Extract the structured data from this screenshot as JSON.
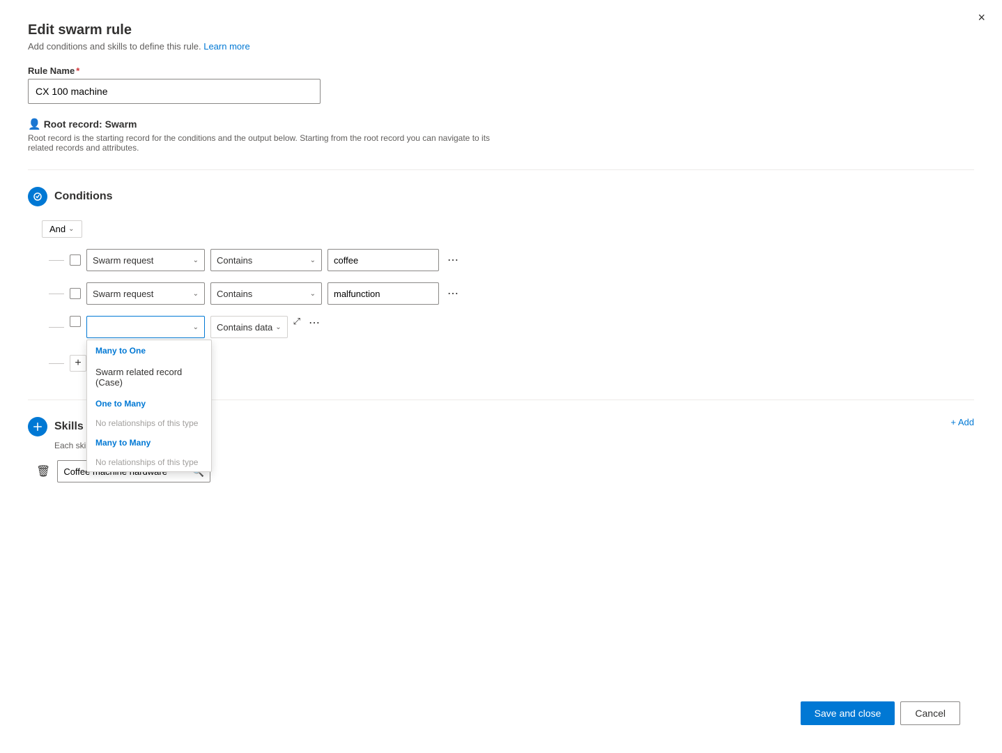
{
  "modal": {
    "title": "Edit swarm rule",
    "subtitle": "Add conditions and skills to define this rule.",
    "learn_more": "Learn more",
    "close_label": "×"
  },
  "rule": {
    "name_label": "Rule Name",
    "name_required": true,
    "name_value": "CX 100 machine",
    "root_record_label": "Root record: Swarm",
    "root_record_desc": "Root record is the starting record for the conditions and the output below. Starting from the root record you can navigate to its related records and attributes."
  },
  "conditions": {
    "section_title": "Conditions",
    "and_label": "And",
    "rows": [
      {
        "field": "Swarm request",
        "operator": "Contains",
        "value": "coffee"
      },
      {
        "field": "Swarm request",
        "operator": "Contains",
        "value": "malfunction"
      }
    ],
    "third_row": {
      "placeholder": "",
      "operator": "Contains data",
      "expand_icon": "⤢"
    },
    "dropdown": {
      "groups": [
        {
          "label": "Many to One",
          "label_type": "category",
          "items": [
            "Swarm related record (Case)"
          ]
        },
        {
          "label": "One to Many",
          "label_type": "category",
          "items": [],
          "empty_msg": "No relationships of this type"
        },
        {
          "label": "Many to Many",
          "label_type": "category",
          "items": [],
          "empty_msg": "No relationships of this type"
        }
      ]
    }
  },
  "skills": {
    "section_title": "Skills",
    "subtitle": "Each skill must be unique.",
    "add_label": "+ Add",
    "items": [
      {
        "value": "Coffee machine hardware"
      }
    ]
  },
  "footer": {
    "save_label": "Save and close",
    "cancel_label": "Cancel"
  }
}
